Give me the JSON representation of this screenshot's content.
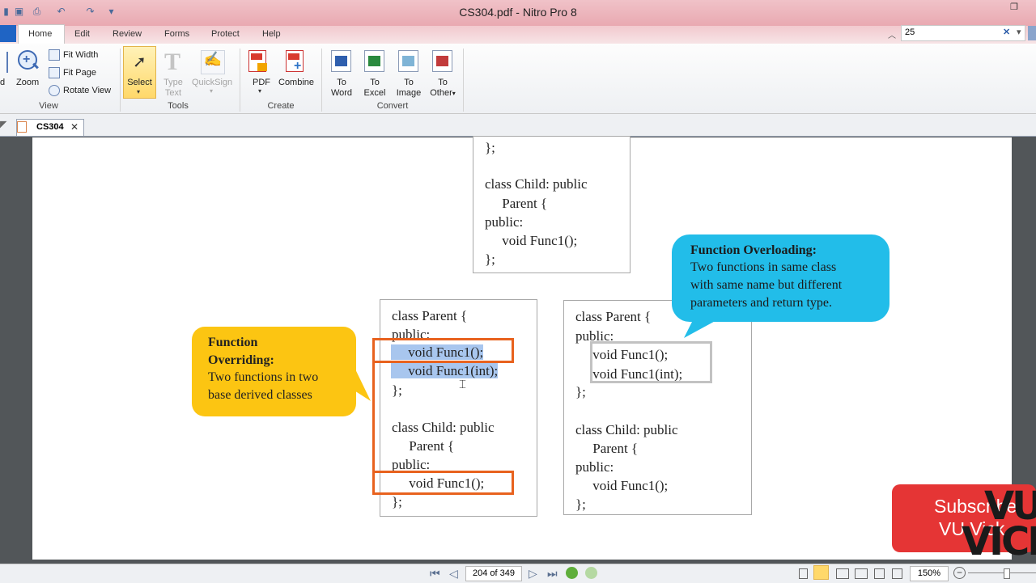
{
  "window": {
    "title": "CS304.pdf - Nitro Pro 8"
  },
  "menu_tabs": [
    "Home",
    "Edit",
    "Review",
    "Forms",
    "Protect",
    "Help"
  ],
  "find": {
    "value": "25"
  },
  "ribbon": {
    "view": {
      "label": "View",
      "partial_label": "d",
      "zoom": "Zoom",
      "fit_width": "Fit Width",
      "fit_page": "Fit Page",
      "rotate_view": "Rotate View"
    },
    "tools": {
      "label": "Tools",
      "select": "Select",
      "type_text_1": "Type",
      "type_text_2": "Text",
      "quicksign": "QuickSign"
    },
    "create": {
      "label": "Create",
      "pdf": "PDF",
      "combine": "Combine"
    },
    "convert": {
      "label": "Convert",
      "to": "To",
      "word": "Word",
      "excel": "Excel",
      "image": "Image",
      "other": "Other"
    }
  },
  "doc_tab": {
    "label": "CS304"
  },
  "document": {
    "top_box": [
      "};",
      "",
      "class Child: public",
      "     Parent {",
      "public:",
      "     void Func1();",
      "};"
    ],
    "left_box": [
      "class Parent {",
      "public:",
      "     void Func1();",
      "     void Func1(int);",
      "};",
      "",
      "class Child: public",
      "     Parent {",
      "public:",
      "     void Func1();",
      "};"
    ],
    "right_box": [
      "class Parent {",
      "public:",
      "     void Func1();",
      "     void Func1(int);",
      "};",
      "",
      "class Child: public",
      "     Parent {",
      "public:",
      "     void Func1();",
      "};"
    ],
    "overriding_callout": {
      "title_1": "Function",
      "title_2": "Overriding:",
      "line_1": "Two functions in two",
      "line_2": "base derived classes"
    },
    "overloading_callout": {
      "title": "Function Overloading:",
      "line_1": "Two functions in same class",
      "line_2": "with same name but different",
      "line_3": "parameters and return type."
    }
  },
  "status": {
    "page_indicator": "204 of 349",
    "zoom": "150%"
  },
  "overlay": {
    "subscribe_1": "Subscribe",
    "subscribe_2": "VU Vick",
    "logo_1": "VU",
    "logo_2": "VICK"
  },
  "colors": {
    "accent_orange": "#e8621e",
    "highlight": "#a8c6ee",
    "callout_yellow": "#fcc512",
    "callout_blue": "#22bde9"
  }
}
